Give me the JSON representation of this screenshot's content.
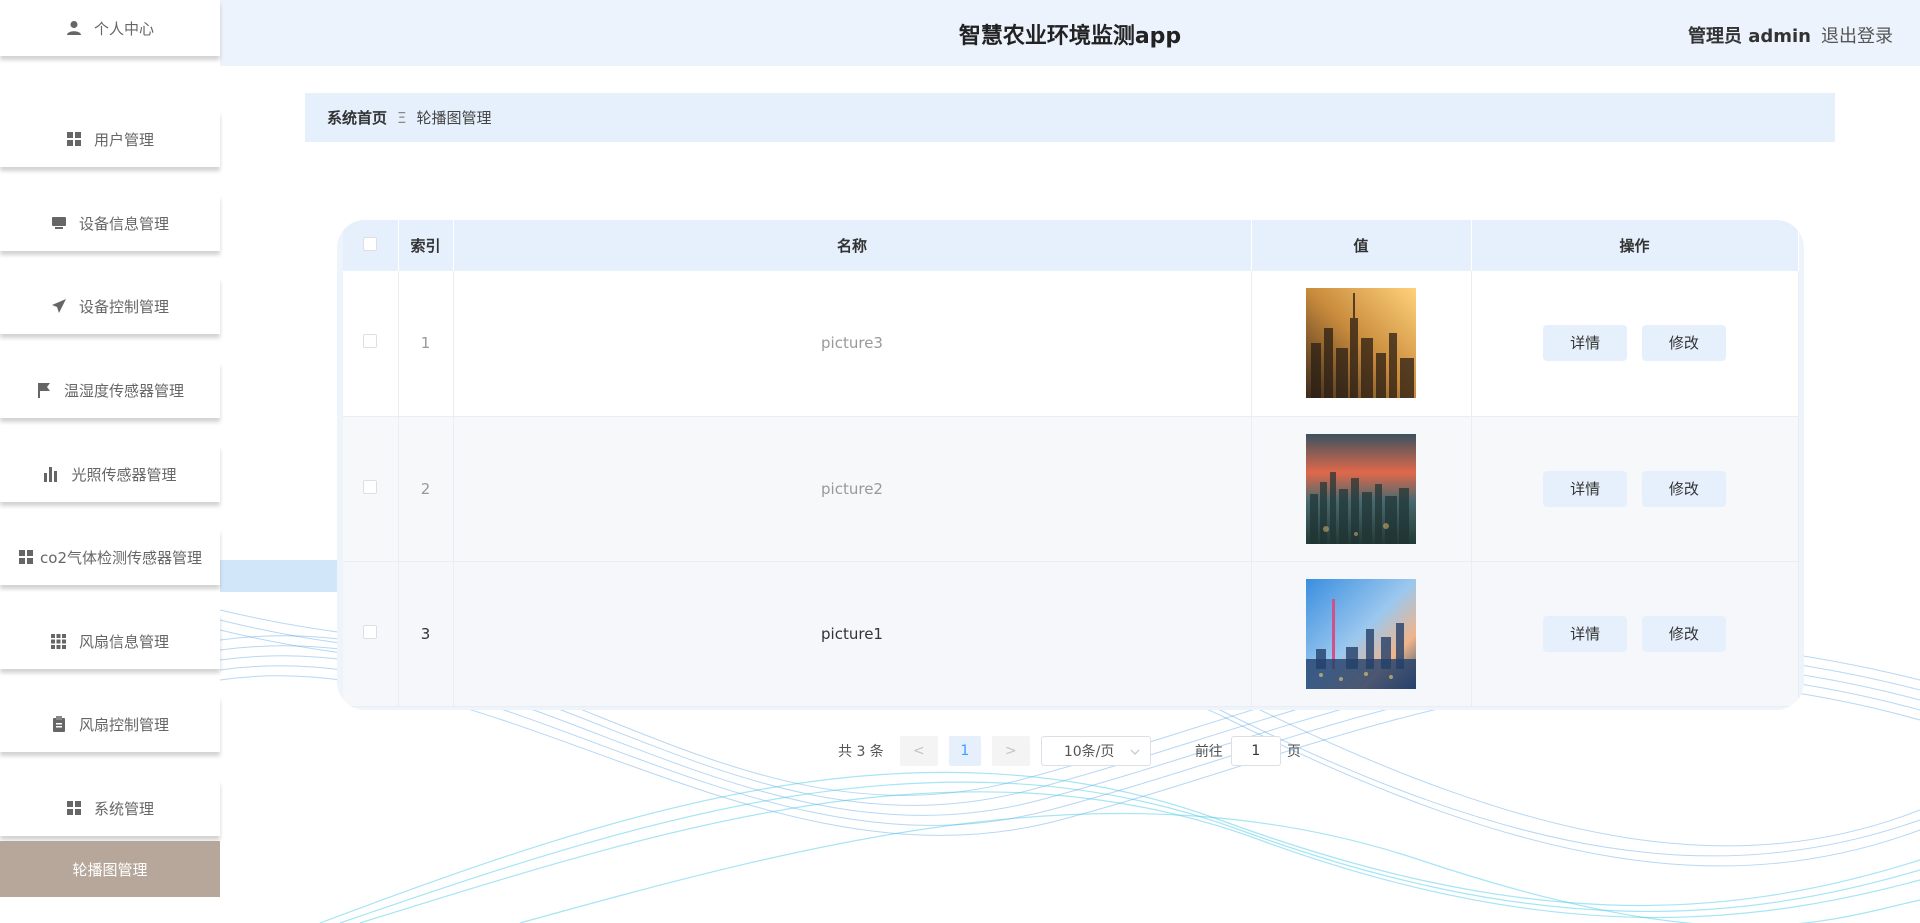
{
  "header": {
    "title": "智慧农业环境监测app",
    "role_label": "管理员 admin",
    "logout_label": "退出登录"
  },
  "sidebar": {
    "items": [
      {
        "label": "个人中心",
        "icon": "user-icon"
      },
      {
        "label": "用户管理",
        "icon": "grid-icon"
      },
      {
        "label": "设备信息管理",
        "icon": "monitor-icon"
      },
      {
        "label": "设备控制管理",
        "icon": "paper-plane-icon"
      },
      {
        "label": "温湿度传感器管理",
        "icon": "flag-icon"
      },
      {
        "label": "光照传感器管理",
        "icon": "bar-chart-icon"
      },
      {
        "label": "co2气体检测传感器管理",
        "icon": "grid-icon"
      },
      {
        "label": "风扇信息管理",
        "icon": "apps-icon"
      },
      {
        "label": "风扇控制管理",
        "icon": "clipboard-icon"
      },
      {
        "label": "系统管理",
        "icon": "grid-icon"
      },
      {
        "label": "轮播图管理",
        "icon": ""
      }
    ],
    "active_index": 10
  },
  "breadcrumb": {
    "home": "系统首页",
    "separator": "Ξ",
    "current": "轮播图管理"
  },
  "table": {
    "columns": [
      "索引",
      "名称",
      "值",
      "操作"
    ],
    "rows": [
      {
        "index": "1",
        "name": "picture3",
        "thumb": "city-sunset-gold-image"
      },
      {
        "index": "2",
        "name": "picture2",
        "thumb": "city-dusk-red-sky-image"
      },
      {
        "index": "3",
        "name": "picture1",
        "thumb": "city-tower-blue-sky-image"
      }
    ],
    "detail_label": "详情",
    "edit_label": "修改"
  },
  "pagination": {
    "total_text": "共 3 条",
    "prev": "<",
    "next": ">",
    "current_page": "1",
    "page_size": "10条/页",
    "jump_label": "前往",
    "jump_value": "1",
    "page_suffix": "页"
  }
}
